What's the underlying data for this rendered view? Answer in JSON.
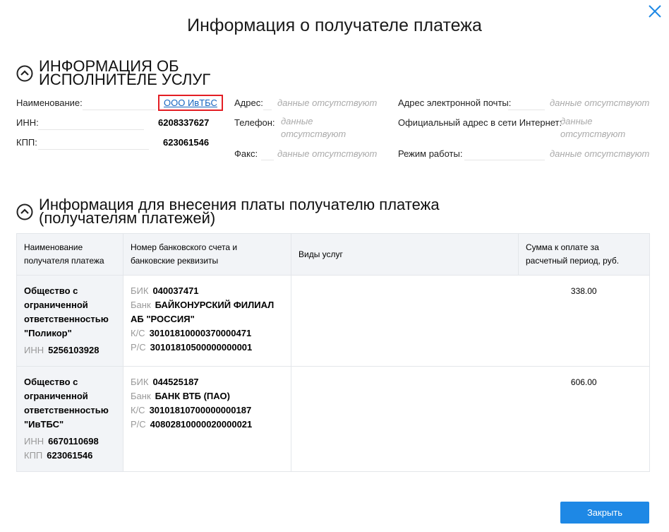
{
  "title": "Информация о получателе платежа",
  "section1": {
    "title": "ИНФОРМАЦИЯ ОБ ИСПОЛНИТЕЛЕ УСЛУГ",
    "name_label": "Наименование:",
    "name_value": "ООО ИвТБС",
    "inn_label": "ИНН:",
    "inn_value": "6208337627",
    "kpp_label": "КПП:",
    "kpp_value": "623061546",
    "address_label": "Адрес:",
    "phone_label": "Телефон:",
    "fax_label": "Факс:",
    "email_label": "Адрес электронной почты:",
    "website_label": "Официальный адрес в сети Интернет:",
    "hours_label": "Режим работы:",
    "no_data": "данные отсутствуют"
  },
  "section2": {
    "title": "Информация для внесения платы получателю платежа (получателям платежей)",
    "headers": [
      "Наименование получателя платежа",
      "Номер банковского счета и банковские реквизиты",
      "Виды услуг",
      "Сумма к оплате за расчетный период, руб."
    ],
    "rows": [
      {
        "name": "Общество с ограниченной ответственностью \"Поликор\"",
        "inn_label": "ИНН",
        "inn": "5256103928",
        "bik_label": "БИК",
        "bik": "040037471",
        "bank_label": "Банк",
        "bank": "БАЙКОНУРСКИЙ ФИЛИАЛ АБ \"РОССИЯ\"",
        "ks_label": "К/С",
        "ks": "30101810000370000471",
        "rs_label": "Р/С",
        "rs": "30101810500000000001",
        "services": "",
        "sum": "338.00"
      },
      {
        "name": "Общество с ограниченной ответственностью \"ИвТБС\"",
        "inn_label": "ИНН",
        "inn": "6670110698",
        "kpp_label": "КПП",
        "kpp": "623061546",
        "bik_label": "БИК",
        "bik": "044525187",
        "bank_label": "Банк",
        "bank": "БАНК ВТБ (ПАО)",
        "ks_label": "К/С",
        "ks": "30101810700000000187",
        "rs_label": "Р/С",
        "rs": "40802810000020000021",
        "services": "",
        "sum": "606.00"
      }
    ]
  },
  "close_button": "Закрыть"
}
